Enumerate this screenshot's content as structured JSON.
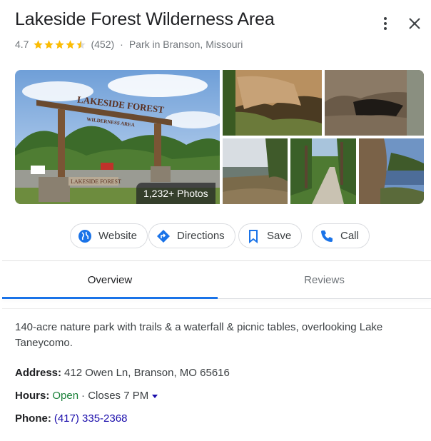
{
  "place": {
    "title": "Lakeside Forest Wilderness Area",
    "rating": "4.7",
    "stars": 4.5,
    "review_count": "(452)",
    "separator": "·",
    "category": "Park in Branson, Missouri"
  },
  "photos": {
    "count_label": "1,232+ Photos",
    "sign_text": "LAKESIDE FOREST",
    "sign_subtext": "WILDERNESS AREA",
    "base_sign": "LAKESIDE FOREST"
  },
  "actions": [
    {
      "label": "Website",
      "icon": "globe-icon"
    },
    {
      "label": "Directions",
      "icon": "directions-icon"
    },
    {
      "label": "Save",
      "icon": "bookmark-icon"
    },
    {
      "label": "Call",
      "icon": "phone-icon"
    }
  ],
  "tabs": {
    "overview": "Overview",
    "reviews": "Reviews",
    "active": "overview"
  },
  "overview": {
    "description": "140-acre nature park with trails & a waterfall & picnic tables, overlooking Lake Taneycomo.",
    "address_label": "Address:",
    "address": "412 Owen Ln, Branson, MO 65616",
    "hours_label": "Hours:",
    "hours_status": "Open",
    "hours_detail": "· Closes 7 PM",
    "phone_label": "Phone:",
    "phone": "(417) 335-2368"
  },
  "colors": {
    "accent": "#1a73e8",
    "star": "#fbbc04",
    "open": "#188038",
    "link": "#1a0dab"
  }
}
